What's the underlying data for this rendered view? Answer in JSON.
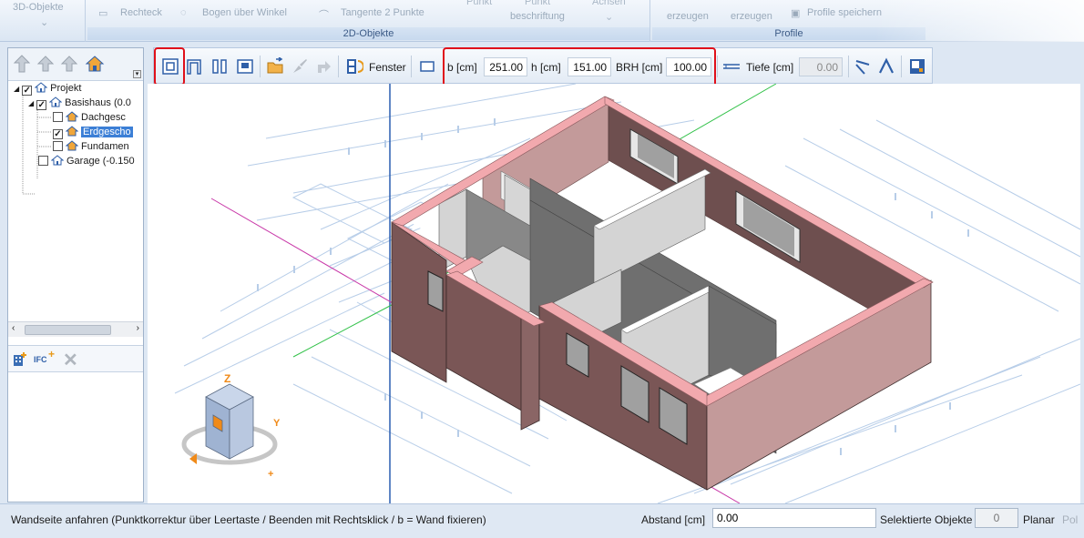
{
  "ribbon": {
    "group_3d": "3D-Objekte",
    "rechteck": "Rechteck",
    "bogen": "Bogen über Winkel",
    "tangente": "Tangente 2 Punkte",
    "punkt": "Punkt",
    "punkt2": "Punkt",
    "beschriftung": "beschriftung",
    "achsen": "Achsen",
    "erzeugen1": "erzeugen",
    "erzeugen2": "erzeugen",
    "profilespeichern": "Profile speichern",
    "group_2d": "2D-Objekte",
    "group_profile": "Profile"
  },
  "tree": {
    "items": [
      {
        "label": "Projekt",
        "checked": true
      },
      {
        "label": "Basishaus (0.0",
        "checked": true
      },
      {
        "label": "Dachgesc",
        "checked": false
      },
      {
        "label": "Erdgescho",
        "checked": true
      },
      {
        "label": "Fundamen",
        "checked": false
      },
      {
        "label": "Garage (-0.150",
        "checked": false
      }
    ]
  },
  "left": {
    "ifc_label": "IFC"
  },
  "toolbar": {
    "fenster_label": "Fenster",
    "b_label": "b [cm]",
    "b_value": "251.00",
    "h_label": "h [cm]",
    "h_value": "151.00",
    "brh_label": "BRH [cm]",
    "brh_value": "100.00",
    "tiefe_label": "Tiefe [cm]",
    "tiefe_value": "0.00"
  },
  "status": {
    "message": "Wandseite anfahren (Punktkorrektur über Leertaste / Beenden mit Rechtsklick / b = Wand fixieren)",
    "abstand_label": "Abstand [cm]",
    "abstand_value": "0.00",
    "selektierte_label": "Selektierte Objekte",
    "selektierte_value": "0",
    "planar_label": "Planar",
    "pol_label": "Pol"
  },
  "colors": {
    "accent_red": "#e0101a",
    "wall_top": "#f2a9ae",
    "wall_outer": "#7a5656",
    "wall_inner": "#c39a9a",
    "inner_wall_dark": "#6f6f6f",
    "inner_wall_light": "#d4d4d4",
    "selection_blue": "#3c7fd6"
  },
  "icons": [
    "wall-icon",
    "u-wall-icon",
    "double-wall-icon",
    "opening-icon",
    "folder-open-icon",
    "brush-icon",
    "arrow-icon",
    "fenster-icon",
    "rect-icon",
    "line-icon",
    "slope-icon",
    "roof-icon",
    "layout-icon",
    "nav-cube-icon"
  ]
}
